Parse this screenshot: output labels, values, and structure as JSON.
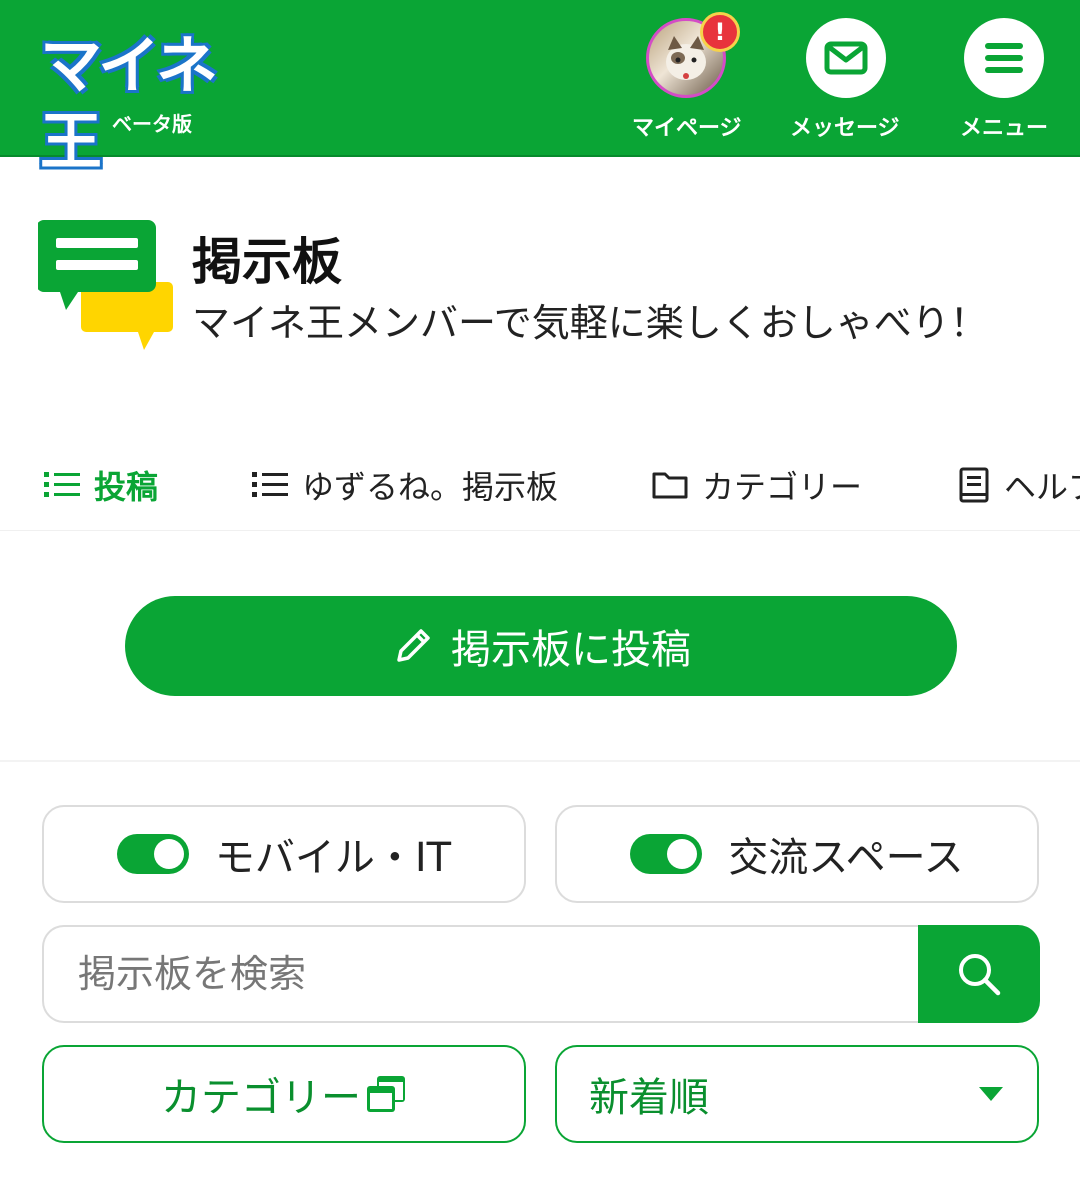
{
  "header": {
    "logo_text": "マイネ王",
    "logo_sub": "ベータ版",
    "nav": {
      "mypage_label": "マイページ",
      "mypage_badge": "!",
      "messages_label": "メッセージ",
      "menu_label": "メニュー"
    }
  },
  "board": {
    "title": "掲示板",
    "subtitle": "マイネ王メンバーで気軽に楽しくおしゃべり！"
  },
  "tabs": [
    {
      "label": "投稿",
      "active": true
    },
    {
      "label": "ゆずるね。掲示板",
      "active": false
    },
    {
      "label": "カテゴリー",
      "active": false
    },
    {
      "label": "ヘルプ",
      "active": false
    }
  ],
  "post_button": {
    "label": "掲示板に投稿"
  },
  "toggles": [
    {
      "label": "モバイル・IT",
      "on": true
    },
    {
      "label": "交流スペース",
      "on": true
    }
  ],
  "search": {
    "placeholder": "掲示板を検索"
  },
  "filters": {
    "category_label": "カテゴリー",
    "sort_selected": "新着順"
  },
  "colors": {
    "brand_green": "#0aa535",
    "accent_yellow": "#ffd500",
    "badge_red": "#e8333c"
  }
}
